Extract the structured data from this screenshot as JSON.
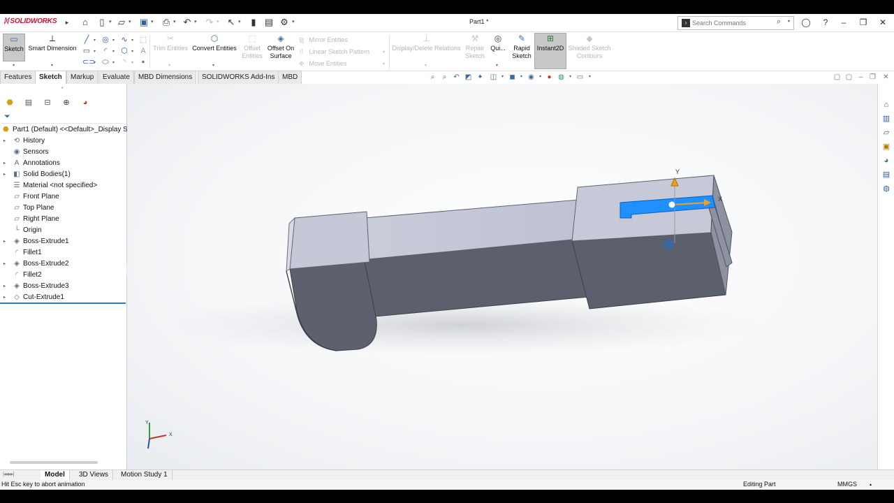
{
  "app": {
    "logo_text": "SOLIDWORKS",
    "document_title": "Part1 *"
  },
  "search": {
    "placeholder": "Search Commands"
  },
  "commands": {
    "sketch": "Sketch",
    "smart_dimension": "Smart Dimension",
    "trim_entities": "Trim Entities",
    "convert_entities": "Convert Entities",
    "offset_entities": "Offset Entities",
    "offset_on_surface": "Offset On Surface",
    "mirror_entities": "Mirror Entities",
    "linear_sketch_pattern": "Linear Sketch Pattern",
    "move_entities": "Move Entities",
    "display_delete_relations": "Display/Delete Relations",
    "repair_sketch": "Repair Sketch",
    "quick_snaps": "Qui...",
    "rapid_sketch": "Rapid Sketch",
    "instant2d": "Instant2D",
    "shaded_sketch_contours": "Shaded Sketch Contours"
  },
  "tabs": [
    "Features",
    "Sketch",
    "Markup",
    "Evaluate",
    "MBD Dimensions",
    "SOLIDWORKS Add-Ins",
    "MBD"
  ],
  "active_tab": "Sketch",
  "tree": {
    "root": "Part1 (Default) <<Default>_Display S",
    "items": [
      {
        "label": "History",
        "icon": "history-icon",
        "expandable": true
      },
      {
        "label": "Sensors",
        "icon": "sensors-icon",
        "expandable": false
      },
      {
        "label": "Annotations",
        "icon": "annotations-icon",
        "expandable": true
      },
      {
        "label": "Solid Bodies(1)",
        "icon": "solid-bodies-icon",
        "expandable": true
      },
      {
        "label": "Material <not specified>",
        "icon": "material-icon",
        "expandable": false
      },
      {
        "label": "Front Plane",
        "icon": "plane-icon",
        "expandable": false
      },
      {
        "label": "Top Plane",
        "icon": "plane-icon",
        "expandable": false
      },
      {
        "label": "Right Plane",
        "icon": "plane-icon",
        "expandable": false
      },
      {
        "label": "Origin",
        "icon": "origin-icon",
        "expandable": false
      },
      {
        "label": "Boss-Extrude1",
        "icon": "extrude-icon",
        "expandable": true
      },
      {
        "label": "Fillet1",
        "icon": "fillet-icon",
        "expandable": false
      },
      {
        "label": "Boss-Extrude2",
        "icon": "extrude-icon",
        "expandable": true
      },
      {
        "label": "Fillet2",
        "icon": "fillet-icon",
        "expandable": false
      },
      {
        "label": "Boss-Extrude3",
        "icon": "extrude-icon",
        "expandable": true
      },
      {
        "label": "Cut-Extrude1",
        "icon": "cut-extrude-icon",
        "expandable": true
      }
    ]
  },
  "triad": {
    "y_label": "Y",
    "x_label": "X"
  },
  "view_triad": {
    "y_label": "Y",
    "x_label": "X"
  },
  "bottom_tabs": [
    "Model",
    "3D Views",
    "Motion Study 1"
  ],
  "active_bottom_tab": "Model",
  "status": {
    "message": "Hit Esc key to abort animation",
    "mode": "Editing Part",
    "units": "MMGS"
  },
  "colors": {
    "selection_blue": "#1e90ff",
    "model_light": "#c3c7d8",
    "model_dark": "#5a5f6b",
    "brand_red": "#c8102e"
  }
}
